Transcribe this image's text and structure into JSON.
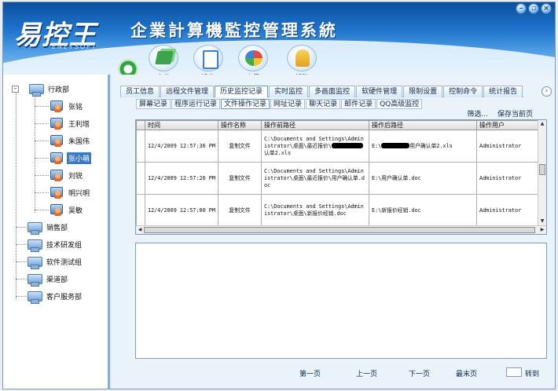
{
  "header": {
    "logo_text": "易控王",
    "logo_sub": "ENETSOFT",
    "app_title": "企業計算機監控管理系統"
  },
  "toolbar": {
    "file": "文件",
    "operate": "操作",
    "view": "查看",
    "help": "帮助"
  },
  "tree": {
    "groups": [
      {
        "label": "行政部"
      },
      {
        "label": "销售部"
      },
      {
        "label": "技术研发组"
      },
      {
        "label": "软件测试组"
      },
      {
        "label": "渠道部"
      },
      {
        "label": "客户服务部"
      }
    ],
    "users": [
      {
        "label": "张铭"
      },
      {
        "label": "王利增"
      },
      {
        "label": "朱国伟"
      },
      {
        "label": "张小萌"
      },
      {
        "label": "刘锐"
      },
      {
        "label": "明兴明"
      },
      {
        "label": "吴敏"
      }
    ],
    "selected_user": "张小萌"
  },
  "tabs_main": [
    {
      "label": "员工信息"
    },
    {
      "label": "远程文件管理"
    },
    {
      "label": "历史监控记录"
    },
    {
      "label": "实时监控"
    },
    {
      "label": "多画面监控"
    },
    {
      "label": "软硬件管理"
    },
    {
      "label": "限制设置"
    },
    {
      "label": "控制命令"
    },
    {
      "label": "统计报告"
    }
  ],
  "active_main_tab": "历史监控记录",
  "tabs_sub": [
    {
      "label": "屏幕记录"
    },
    {
      "label": "程序运行记录"
    },
    {
      "label": "文件操作记录"
    },
    {
      "label": "网址记录"
    },
    {
      "label": "聊天记录"
    },
    {
      "label": "邮件记录"
    },
    {
      "label": "QQ高级监控"
    }
  ],
  "active_sub_tab": "文件操作记录",
  "actions": {
    "filter": "筛选...",
    "save_page": "保存当前页"
  },
  "table": {
    "columns": [
      "时间",
      "操作名称",
      "操作前路径",
      "操作后路径",
      "操作用户"
    ],
    "rows": [
      {
        "time": "12/4/2009 12:57:36 PM",
        "action": "复制文件",
        "before": "C:\\Documents and Settings\\Administrator\\桌面\\最近报价\\",
        "before_tail": "认单2.xls",
        "after": "E:\\",
        "after_tail": "用户确认单2.xls",
        "user": "Administrator"
      },
      {
        "time": "12/4/2009 12:57:26 PM",
        "action": "复制文件",
        "before": "C:\\Documents and Settings\\Administrator\\桌面\\最近报价\\用户确认单.doc",
        "before_tail": "",
        "after": "E:\\用户确认单.doc",
        "after_tail": "",
        "user": "Administrator"
      },
      {
        "time": "12/4/2009 12:57:00 PM",
        "action": "复制文件",
        "before": "C:\\Documents and Settings\\Administrator\\桌面\\新报价经销.doc",
        "before_tail": "",
        "after": "E:\\新报价经销.doc",
        "after_tail": "",
        "user": "Administrator"
      }
    ]
  },
  "pager": {
    "first": "第一页",
    "prev": "上一页",
    "next": "下一页",
    "last": "最末页",
    "jump": "转到"
  },
  "colors": {
    "header_blue": "#1e74cc",
    "selection": "#3a78c8"
  }
}
